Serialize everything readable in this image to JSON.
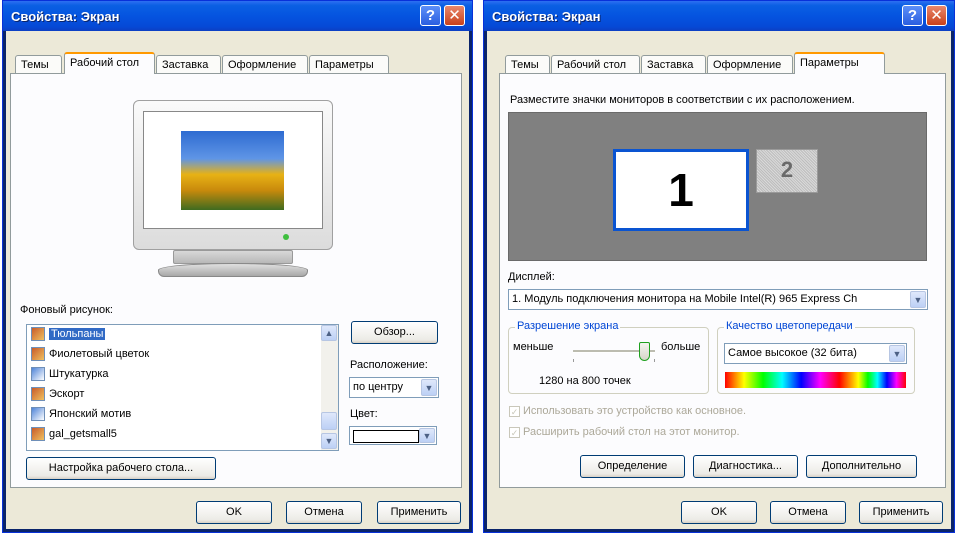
{
  "left_window": {
    "title": "Свойства: Экран",
    "tabs": [
      "Темы",
      "Рабочий стол",
      "Заставка",
      "Оформление",
      "Параметры"
    ],
    "background_label": "Фоновый рисунок:",
    "wallpapers": [
      "Тюльпаны",
      "Фиолетовый цветок",
      "Штукатурка",
      "Эскорт",
      "Японский мотив",
      "gal_getsmall5"
    ],
    "browse_button": "Обзор...",
    "position_label": "Расположение:",
    "position_value": "по центру",
    "color_label": "Цвет:",
    "customize_button": "Настройка рабочего стола...",
    "ok": "OK",
    "cancel": "Отмена",
    "apply": "Применить"
  },
  "right_window": {
    "title": "Свойства: Экран",
    "tabs": [
      "Темы",
      "Рабочий стол",
      "Заставка",
      "Оформление",
      "Параметры"
    ],
    "instruction": "Разместите значки мониторов в соответствии с их расположением.",
    "monitor1": "1",
    "monitor2": "2",
    "display_label": "Дисплей:",
    "display_value": "1. Модуль подключения монитора на Mobile Intel(R) 965 Express Ch",
    "resolution_group": "Разрешение экрана",
    "less": "меньше",
    "more": "больше",
    "resolution_value": "1280 на 800 точек",
    "color_group": "Качество цветопередачи",
    "color_value": "Самое высокое (32 бита)",
    "checkbox1": "Использовать это устройство как основное.",
    "checkbox2": "Расширить рабочий стол на этот монитор.",
    "identify": "Определение",
    "troubleshoot": "Диагностика...",
    "advanced": "Дополнительно",
    "ok": "OK",
    "cancel": "Отмена",
    "apply": "Применить"
  },
  "colors": {
    "title_blue": "#0554e0",
    "tab_highlight": "#ff9900",
    "selection": "#316ac5",
    "desktop_gray": "#808080"
  },
  "icons": [
    "help-icon",
    "close-icon",
    "scroll-up-icon",
    "scroll-down-icon",
    "dropdown-icon",
    "file-icon"
  ]
}
